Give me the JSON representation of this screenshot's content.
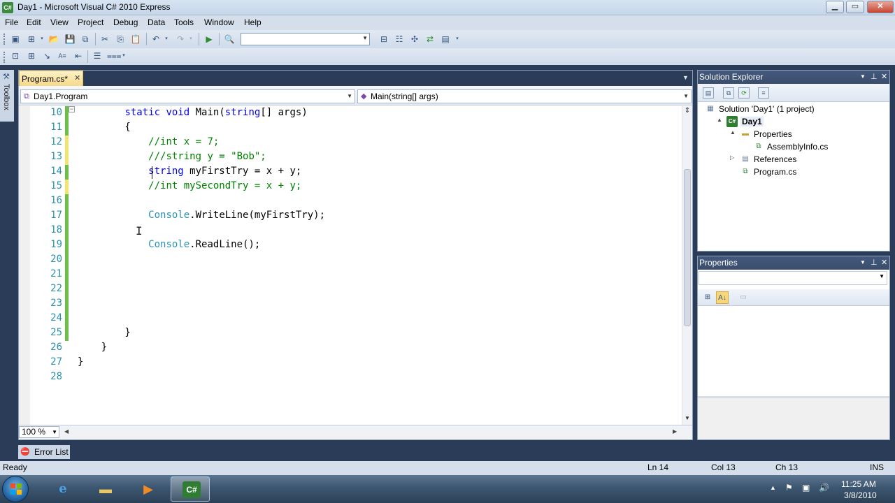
{
  "window": {
    "title": "Day1 - Microsoft Visual C# 2010 Express",
    "app_icon": "C#"
  },
  "menu": [
    "File",
    "Edit",
    "View",
    "Project",
    "Debug",
    "Data",
    "Tools",
    "Window",
    "Help"
  ],
  "toolbox": {
    "label": "Toolbox"
  },
  "editor": {
    "tab_label": "Program.cs*",
    "class_combo": "Day1.Program",
    "member_combo": "Main(string[] args)",
    "zoom": "100 %",
    "lines": [
      {
        "n": "10",
        "tokens": [
          [
            "",
            "        "
          ],
          [
            "kw",
            "static"
          ],
          [
            "",
            " "
          ],
          [
            "kw",
            "void"
          ],
          [
            "",
            " Main("
          ],
          [
            "kw",
            "string"
          ],
          [
            "",
            "[] args)"
          ]
        ],
        "change": "saved"
      },
      {
        "n": "11",
        "tokens": [
          [
            "",
            "        {"
          ]
        ],
        "change": "saved"
      },
      {
        "n": "12",
        "tokens": [
          [
            "",
            "            "
          ],
          [
            "cm",
            "//int x = 7;"
          ]
        ],
        "change": "unsaved"
      },
      {
        "n": "13",
        "tokens": [
          [
            "",
            "            "
          ],
          [
            "cm",
            "///string y = \"Bob\";"
          ]
        ],
        "change": "unsaved"
      },
      {
        "n": "14",
        "tokens": [
          [
            "",
            "            "
          ],
          [
            "kw",
            "string"
          ],
          [
            "",
            " myFirstTry = x + y;"
          ]
        ],
        "change": "saved"
      },
      {
        "n": "15",
        "tokens": [
          [
            "",
            "            "
          ],
          [
            "cm",
            "//int mySecondTry = x + y;"
          ]
        ],
        "change": "unsaved"
      },
      {
        "n": "16",
        "tokens": [
          [
            "",
            ""
          ]
        ],
        "change": "saved"
      },
      {
        "n": "17",
        "tokens": [
          [
            "",
            "            "
          ],
          [
            "ty",
            "Console"
          ],
          [
            "",
            ".WriteLine(myFirstTry);"
          ]
        ],
        "change": "saved"
      },
      {
        "n": "18",
        "tokens": [
          [
            "",
            ""
          ]
        ],
        "change": "saved"
      },
      {
        "n": "19",
        "tokens": [
          [
            "",
            "            "
          ],
          [
            "ty",
            "Console"
          ],
          [
            "",
            ".ReadLine();"
          ]
        ],
        "change": "saved"
      },
      {
        "n": "20",
        "tokens": [
          [
            "",
            ""
          ]
        ],
        "change": "saved"
      },
      {
        "n": "21",
        "tokens": [
          [
            "",
            ""
          ]
        ],
        "change": "saved"
      },
      {
        "n": "22",
        "tokens": [
          [
            "",
            ""
          ]
        ],
        "change": "saved"
      },
      {
        "n": "23",
        "tokens": [
          [
            "",
            ""
          ]
        ],
        "change": "saved"
      },
      {
        "n": "24",
        "tokens": [
          [
            "",
            ""
          ]
        ],
        "change": "saved"
      },
      {
        "n": "25",
        "tokens": [
          [
            "",
            "        }"
          ]
        ],
        "change": "saved"
      },
      {
        "n": "26",
        "tokens": [
          [
            "",
            "    }"
          ]
        ],
        "change": "none"
      },
      {
        "n": "27",
        "tokens": [
          [
            "",
            "}"
          ]
        ],
        "change": "none"
      },
      {
        "n": "28",
        "tokens": [
          [
            "",
            ""
          ]
        ],
        "change": "none"
      }
    ],
    "colors": {
      "keyword": "#0000ff",
      "comment": "#008000",
      "type": "#2b91af",
      "saved_change": "#6cc04a",
      "unsaved_change": "#f2e46e"
    }
  },
  "solution_explorer": {
    "title": "Solution Explorer",
    "tree": [
      {
        "label": "Solution 'Day1' (1 project)",
        "icon": "solution-icon",
        "level": 0,
        "expander": ""
      },
      {
        "label": "Day1",
        "icon": "csharp-project-icon",
        "level": 1,
        "expander": "▲",
        "bold": true
      },
      {
        "label": "Properties",
        "icon": "folder-icon",
        "level": 2,
        "expander": "▲"
      },
      {
        "label": "AssemblyInfo.cs",
        "icon": "cs-file-icon",
        "level": 3,
        "expander": ""
      },
      {
        "label": "References",
        "icon": "references-icon",
        "level": 2,
        "expander": "▷"
      },
      {
        "label": "Program.cs",
        "icon": "cs-file-icon",
        "level": 2,
        "expander": ""
      }
    ]
  },
  "properties": {
    "title": "Properties"
  },
  "error_list": {
    "label": "Error List"
  },
  "status": {
    "text": "Ready",
    "line": "Ln 14",
    "col": "Col 13",
    "ch": "Ch 13",
    "mode": "INS"
  },
  "taskbar": {
    "time": "11:25 AM",
    "date": "3/8/2010",
    "vs_glyph": "C#"
  }
}
